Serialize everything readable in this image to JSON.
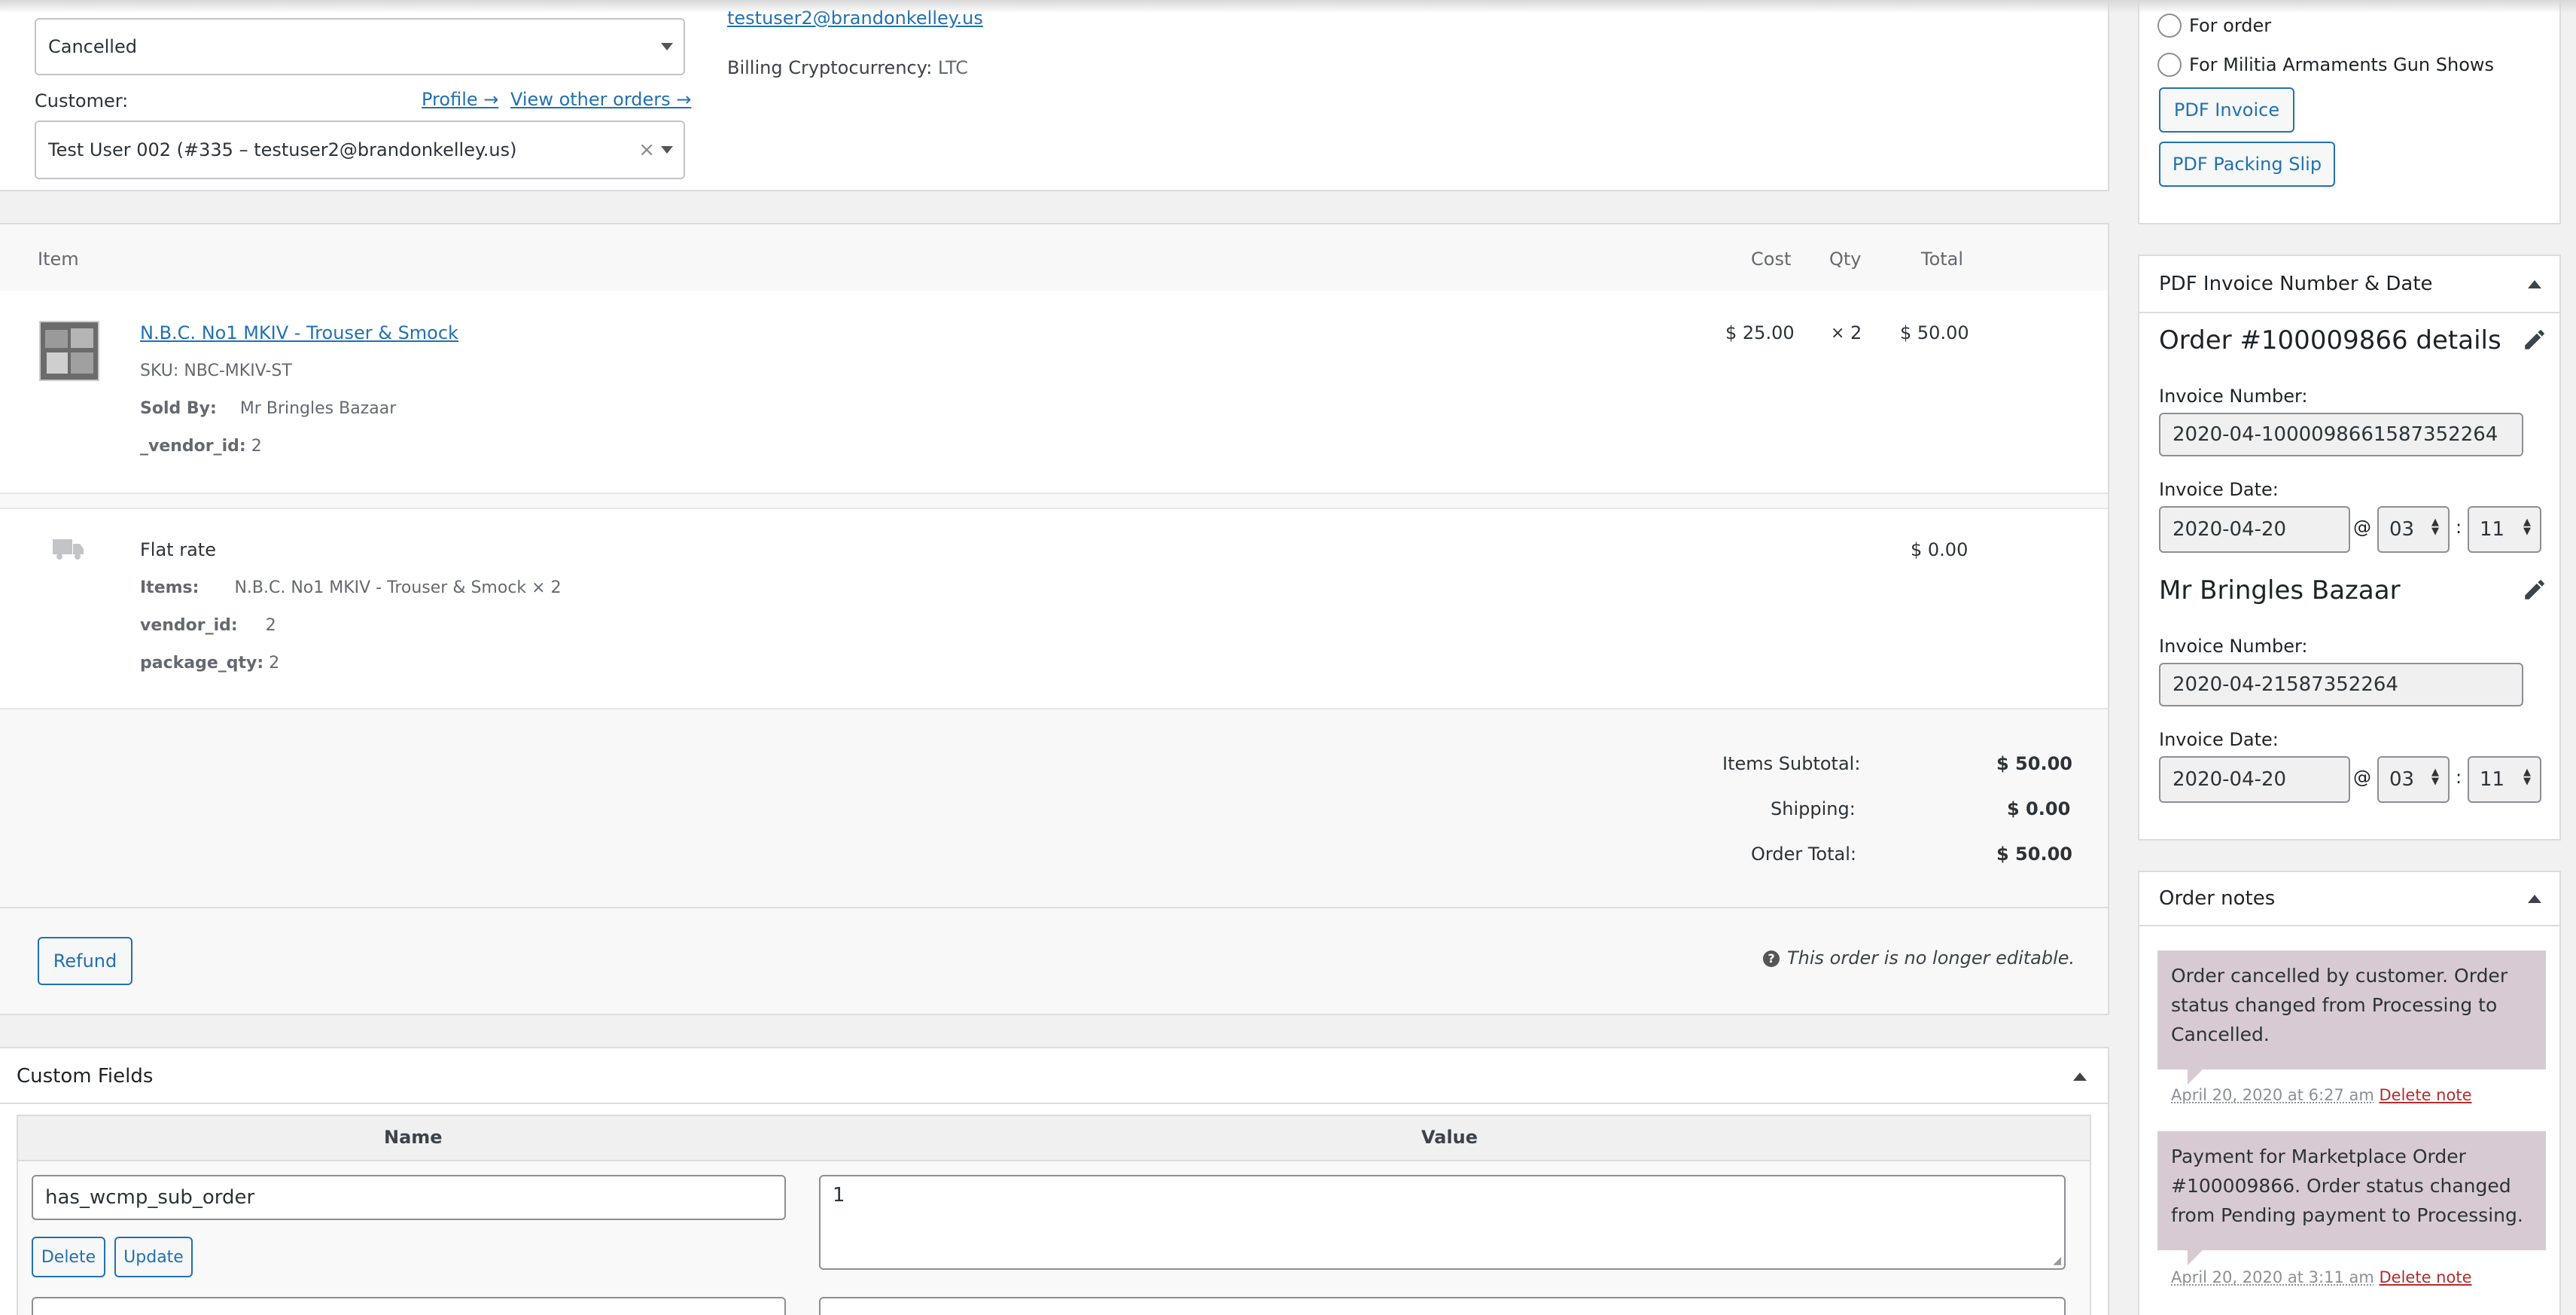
{
  "order": {
    "status_value": "Cancelled",
    "customer_label": "Customer:",
    "profile_link": "Profile →",
    "view_orders_link": "View other orders →",
    "customer_value": "Test User 002 (#335 – testuser2@brandonkelley.us)",
    "email_link": "testuser2@brandonkelley.us",
    "crypto_label": "Billing Cryptocurrency:",
    "crypto_value": "LTC"
  },
  "items": {
    "headers": {
      "item": "Item",
      "cost": "Cost",
      "qty": "Qty",
      "total": "Total"
    },
    "product": {
      "name": "N.B.C. No1 MKIV - Trouser & Smock",
      "sku_label": "SKU:",
      "sku": "NBC-MKIV-ST",
      "sold_by_label": "Sold By:",
      "sold_by": "Mr Bringles Bazaar",
      "vendor_id_label": "_vendor_id:",
      "vendor_id": "2",
      "cost": "$ 25.00",
      "qty_x": "×",
      "qty": "2",
      "total": "$ 50.00"
    },
    "shipping": {
      "name": "Flat rate",
      "items_label": "Items:",
      "items_value": "N.B.C. No1 MKIV - Trouser & Smock × 2",
      "vendor_id_label": "vendor_id:",
      "vendor_id": "2",
      "package_qty_label": "package_qty:",
      "package_qty": "2",
      "total": "$ 0.00"
    },
    "totals": {
      "subtotal_label": "Items Subtotal:",
      "subtotal": "$ 50.00",
      "shipping_label": "Shipping:",
      "shipping": "$ 0.00",
      "order_total_label": "Order Total:",
      "order_total": "$ 50.00"
    },
    "refund_button": "Refund",
    "not_editable": "This order is no longer editable."
  },
  "custom_fields": {
    "title": "Custom Fields",
    "name_header": "Name",
    "value_header": "Value",
    "row1_name": "has_wcmp_sub_order",
    "row1_value": "1",
    "delete_button": "Delete",
    "update_button": "Update"
  },
  "sidebar": {
    "radio1": "For order",
    "radio2": "For Militia Armaments Gun Shows",
    "pdf_invoice_button": "PDF Invoice",
    "pdf_packing_button": "PDF Packing Slip",
    "invoice_box_title": "PDF Invoice Number & Date",
    "order_details_title": "Order #100009866 details",
    "invoice_number_label": "Invoice Number:",
    "invoice_number_1": "2020-04-1000098661587352264",
    "invoice_date_label": "Invoice Date:",
    "invoice_date_1": "2020-04-20",
    "at": "@",
    "colon": ":",
    "hour_1": "03",
    "minute_1": "11",
    "vendor_title": "Mr Bringles Bazaar",
    "invoice_number_2": "2020-04-21587352264",
    "invoice_date_2": "2020-04-20",
    "hour_2": "03",
    "minute_2": "11",
    "notes_title": "Order notes",
    "note1_text": "Order cancelled by customer. Order status changed from Processing to Cancelled.",
    "note1_meta": "April 20, 2020 at 6:27 am",
    "note2_text": "Payment for Marketplace Order #100009866. Order status changed from Pending payment to Processing.",
    "note2_meta": "April 20, 2020 at 3:11 am",
    "delete_note": "Delete note"
  },
  "colors": {
    "accent": "#2271b1",
    "note_bg": "#d7cad2",
    "delete": "#b32d2e"
  }
}
